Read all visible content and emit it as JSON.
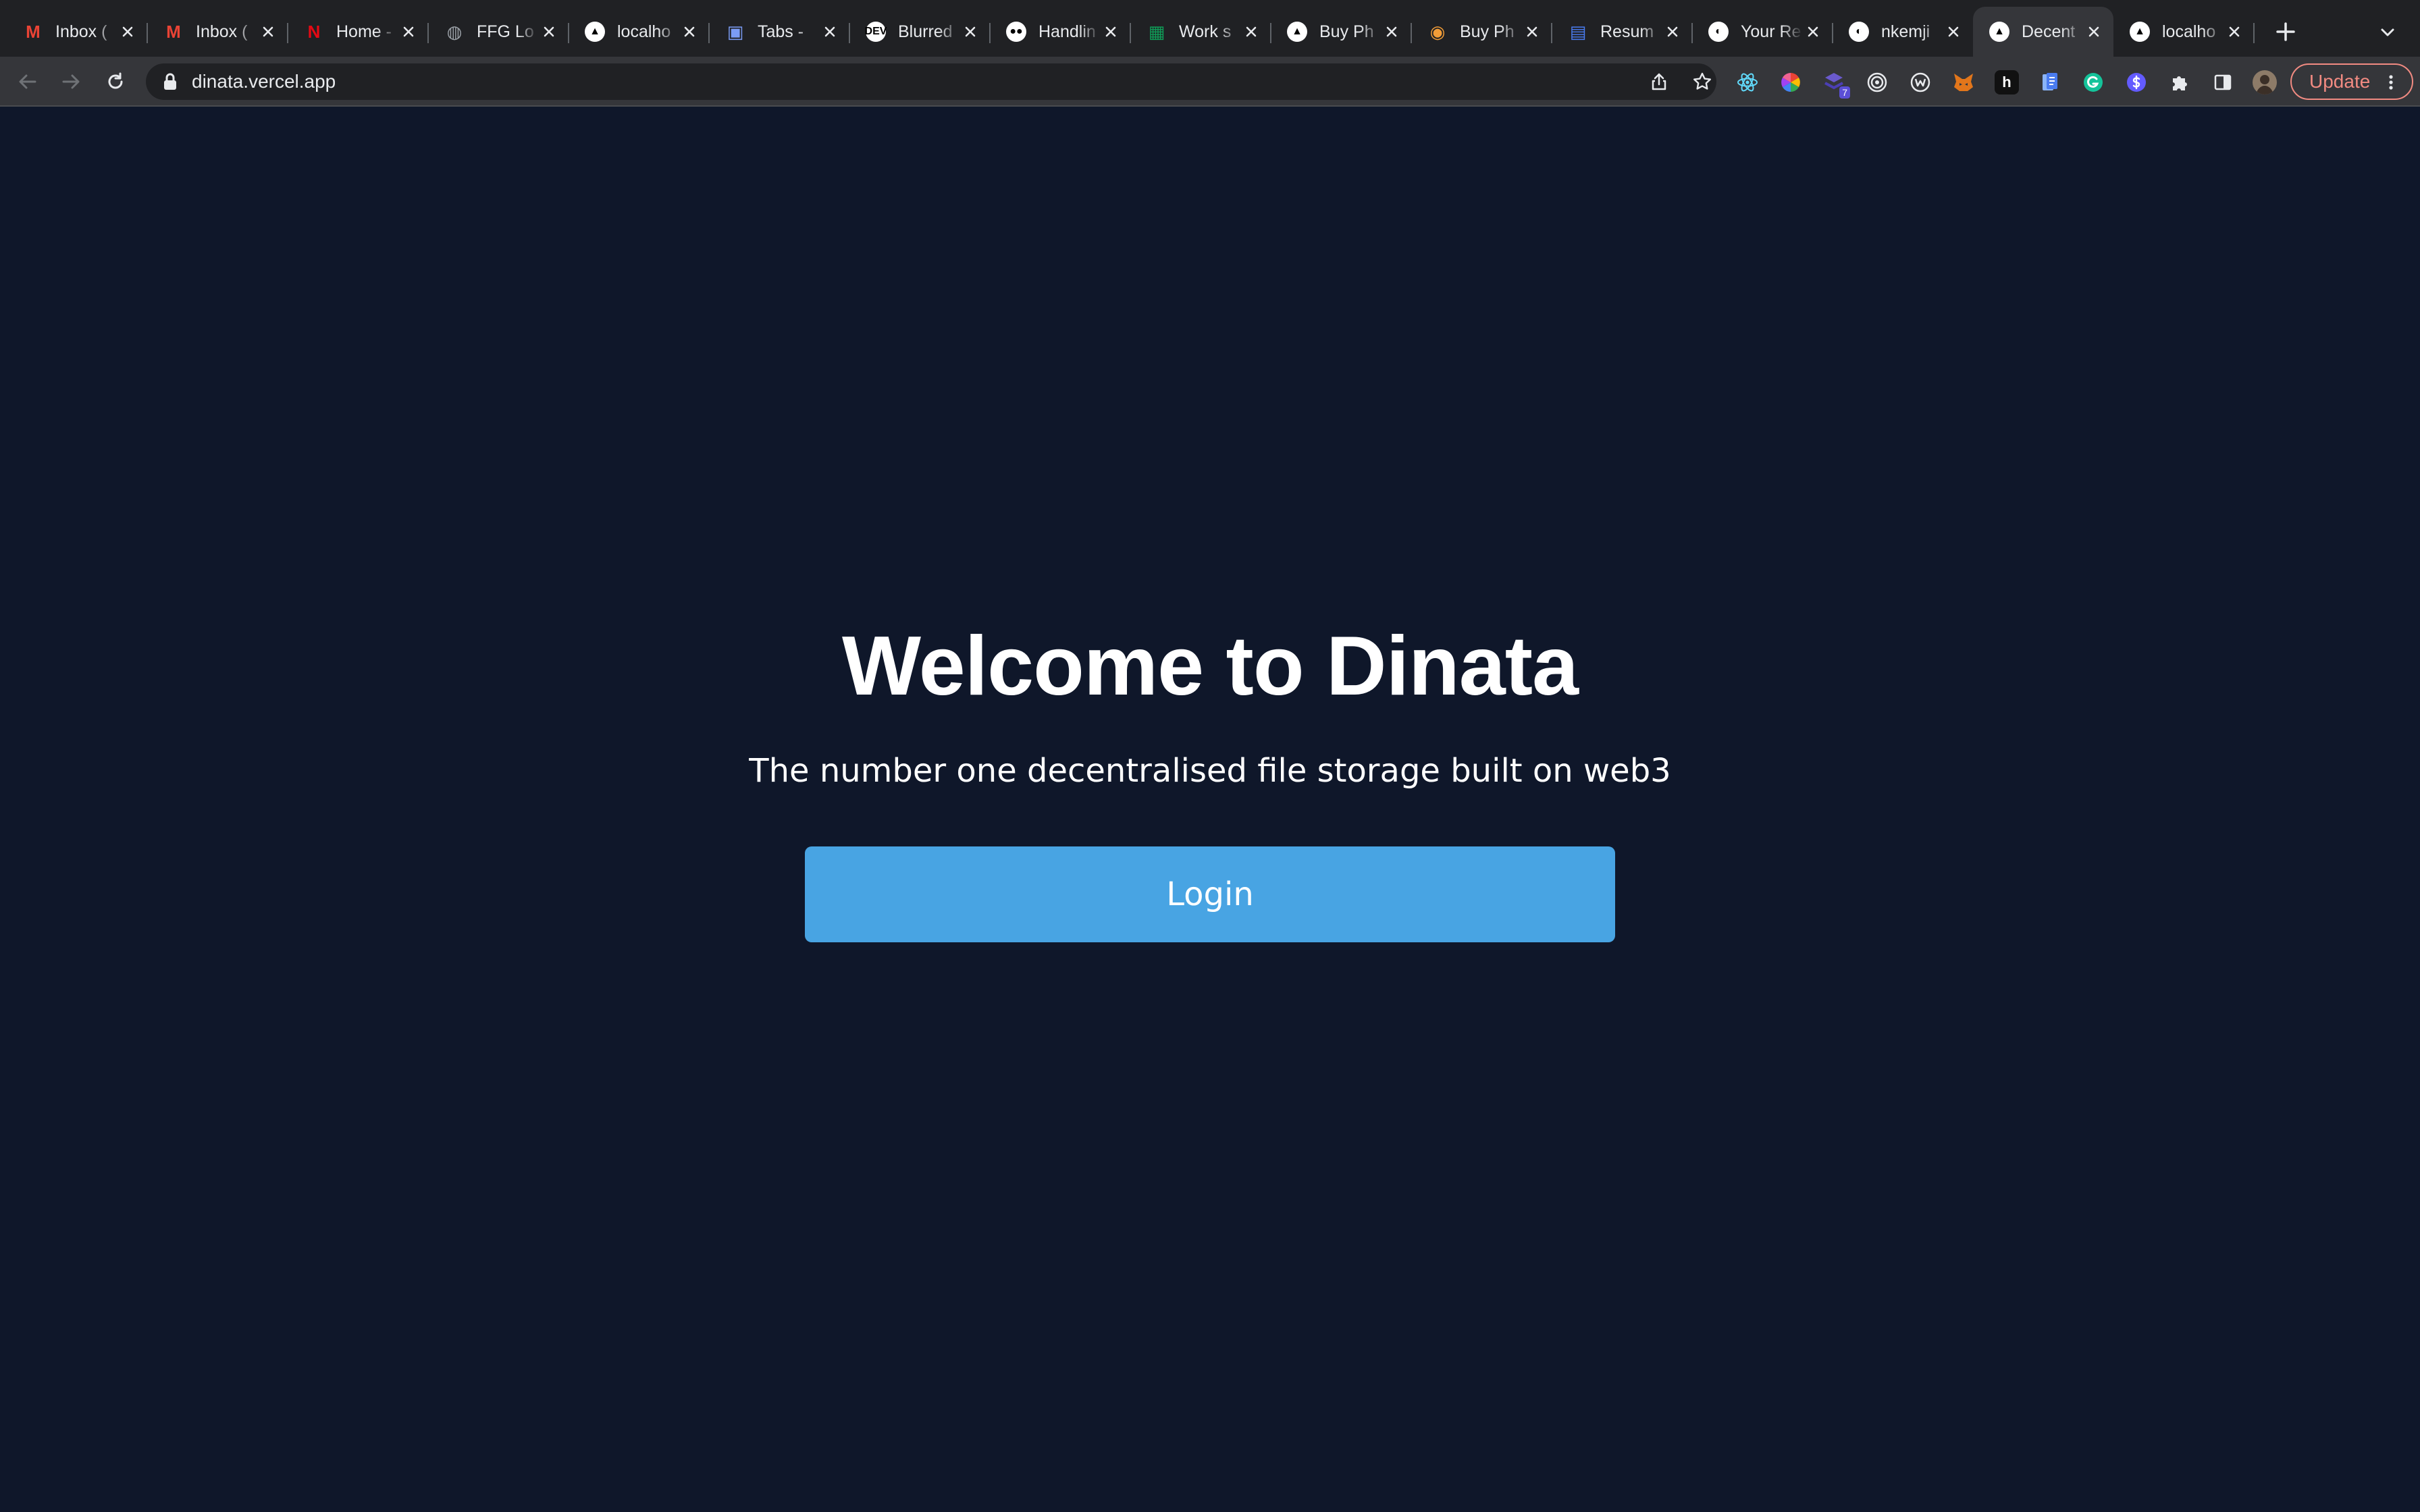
{
  "browser": {
    "tabs": [
      {
        "title": "Inbox (",
        "favicon": "gmail-icon",
        "favicon_text": "M",
        "favicon_color": "#ea4335"
      },
      {
        "title": "Inbox (",
        "favicon": "gmail-icon",
        "favicon_text": "M",
        "favicon_color": "#ea4335"
      },
      {
        "title": "Home -",
        "favicon": "netflix-icon",
        "favicon_text": "N",
        "favicon_color": "#e50914"
      },
      {
        "title": "FFG Lo",
        "favicon": "globe-icon",
        "favicon_text": "◍",
        "favicon_color": "#9aa0a6"
      },
      {
        "title": "localho",
        "favicon": "vercel-icon",
        "favicon_text": "▲",
        "favicon_color": "#000000"
      },
      {
        "title": "Tabs -",
        "favicon": "tabs-app-icon",
        "favicon_text": "▣",
        "favicon_color": "#7b9cf5"
      },
      {
        "title": "Blurred",
        "favicon": "dev-icon",
        "favicon_text": "DEV",
        "favicon_color": "#000000"
      },
      {
        "title": "Handlin",
        "favicon": "medium-icon",
        "favicon_text": "●●",
        "favicon_color": "#000000"
      },
      {
        "title": "Work s",
        "favicon": "sheets-icon",
        "favicon_text": "▦",
        "favicon_color": "#0f9d58"
      },
      {
        "title": "Buy Ph",
        "favicon": "vercel-icon",
        "favicon_text": "▲",
        "favicon_color": "#000000"
      },
      {
        "title": "Buy Ph",
        "favicon": "orange-logo-icon",
        "favicon_text": "◉",
        "favicon_color": "#f29d38"
      },
      {
        "title": "Resum",
        "favicon": "resume-icon",
        "favicon_text": "▤",
        "favicon_color": "#4a7cf0"
      },
      {
        "title": "Your Re",
        "favicon": "github-icon",
        "favicon_text": "◐",
        "favicon_color": "#202124"
      },
      {
        "title": "nkemji",
        "favicon": "github-icon",
        "favicon_text": "◐",
        "favicon_color": "#202124"
      },
      {
        "title": "Decent",
        "favicon": "vercel-icon",
        "favicon_text": "▲",
        "favicon_color": "#000000",
        "active": true
      },
      {
        "title": "localho",
        "favicon": "vercel-icon",
        "favicon_text": "▲",
        "favicon_color": "#000000"
      }
    ],
    "url": "dinata.vercel.app",
    "extension_badge": "7",
    "update_label": "Update"
  },
  "page": {
    "title": "Welcome to Dinata",
    "subtitle": "The number one decentralised file storage built on web3",
    "login_label": "Login"
  },
  "colors": {
    "background": "#0f172a",
    "button": "#48a4e3",
    "text": "#ffffff"
  }
}
